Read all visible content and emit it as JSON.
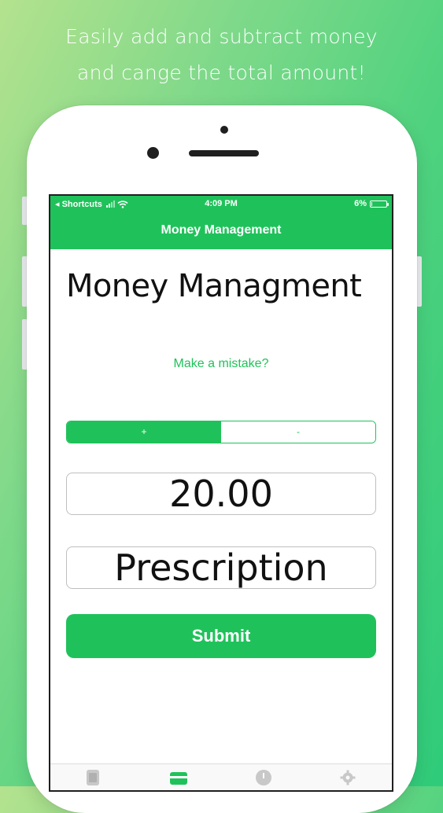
{
  "promo": {
    "line1": "Easily add and subtract money",
    "line2": "and cange the total amount!"
  },
  "status_bar": {
    "carrier": "◂ Shortcuts",
    "time": "4:09 PM",
    "battery": "6%",
    "battery_level": 0.06
  },
  "nav": {
    "title": "Money Management"
  },
  "main": {
    "heading": "Money Managment",
    "mistake_link": "Make a mistake?",
    "segments": [
      {
        "label": "+",
        "selected": true
      },
      {
        "label": "-",
        "selected": false
      }
    ],
    "amount_value": "20.00",
    "description_value": "Prescription",
    "submit_label": "Submit"
  },
  "tab_bar": {
    "tabs": [
      {
        "icon": "document-icon",
        "selected": false
      },
      {
        "icon": "credit-card-icon",
        "selected": true
      },
      {
        "icon": "clock-icon",
        "selected": false
      },
      {
        "icon": "gear-icon",
        "selected": false
      }
    ]
  },
  "colors": {
    "accent": "#1fc25a",
    "background_gradient": [
      "#b4e28e",
      "#2fcb7a"
    ],
    "inactive_icon": "#c8c8c8"
  }
}
